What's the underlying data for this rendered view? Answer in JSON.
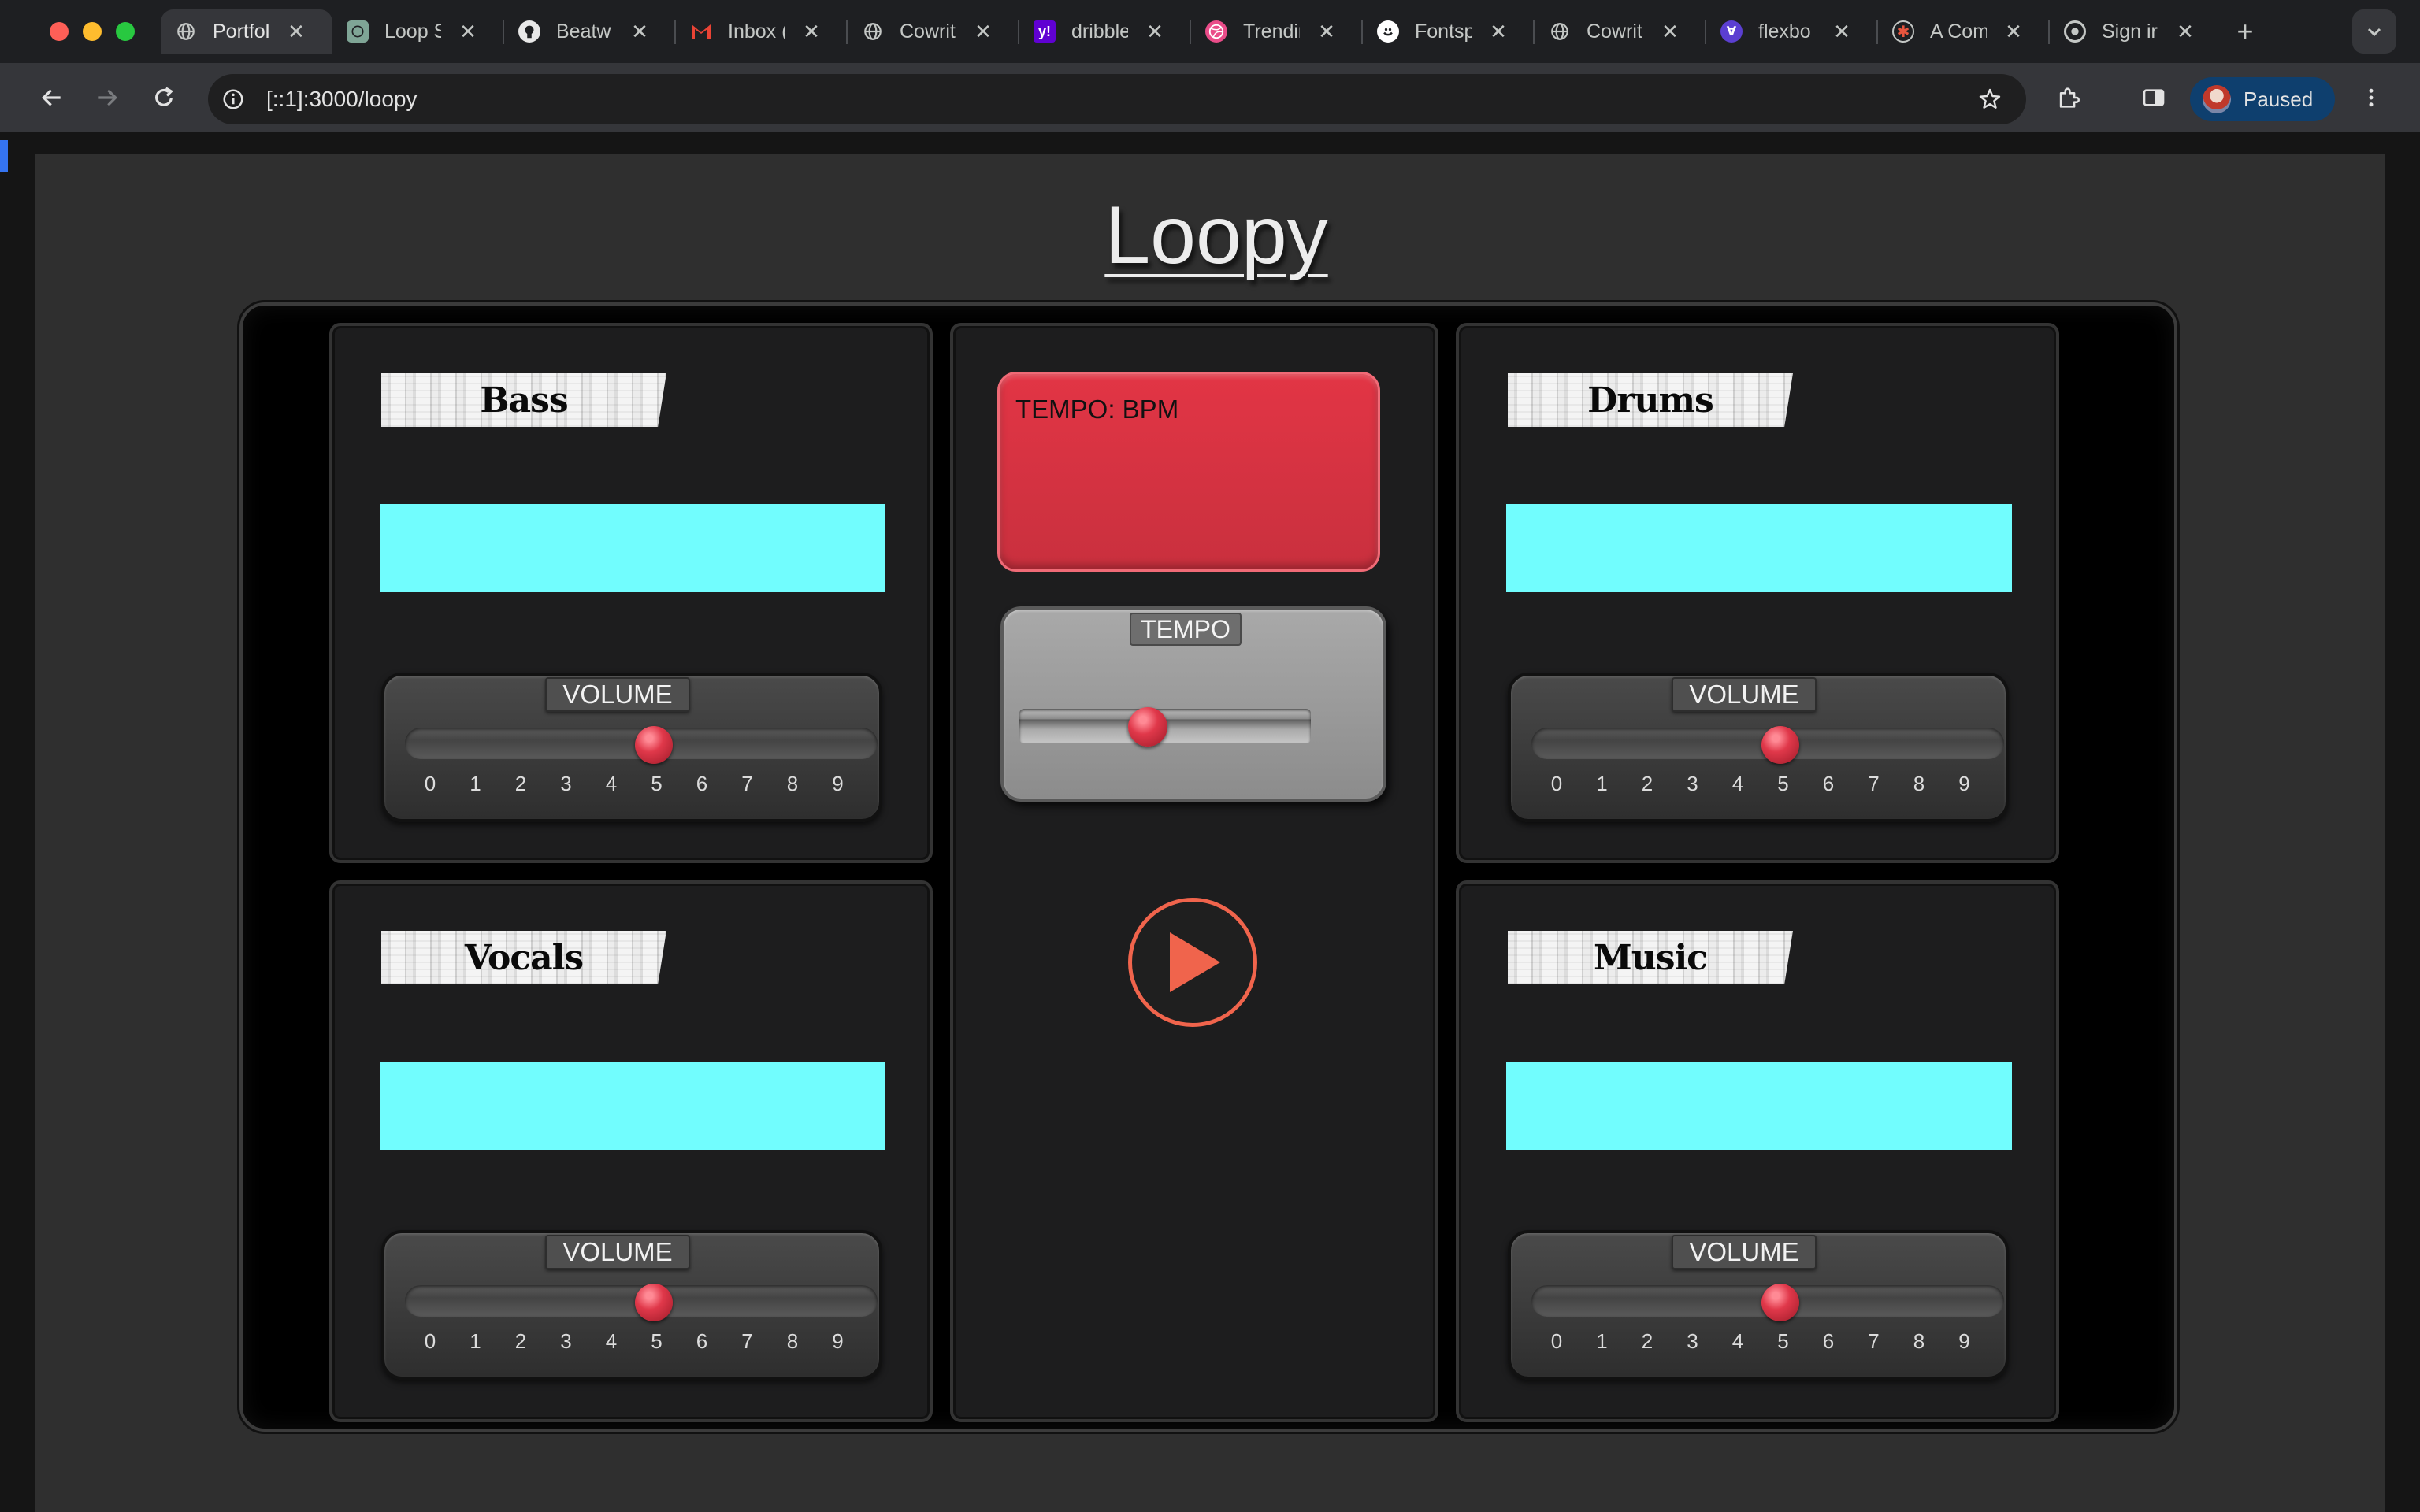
{
  "browser": {
    "tabs": [
      {
        "title": "Portfol",
        "favicon": "globe-icon",
        "active": true
      },
      {
        "title": "Loop S",
        "favicon": "globe-icon",
        "active": false
      },
      {
        "title": "Beatw",
        "favicon": "github-icon",
        "active": false
      },
      {
        "title": "Inbox (",
        "favicon": "gmail-icon",
        "active": false
      },
      {
        "title": "Cowrit",
        "favicon": "globe-icon",
        "active": false
      },
      {
        "title": "dribble",
        "favicon": "yahoo-icon",
        "active": false
      },
      {
        "title": "Trendir",
        "favicon": "dribbble-icon",
        "active": false
      },
      {
        "title": "Fontsp",
        "favicon": "fontspace-icon",
        "active": false
      },
      {
        "title": "Cowrit",
        "favicon": "globe-icon",
        "active": false
      },
      {
        "title": "flexbo",
        "favicon": "flexbox-icon",
        "active": false
      },
      {
        "title": "A Com",
        "favicon": "asterisk-icon",
        "active": false
      },
      {
        "title": "Sign ir",
        "favicon": "google-icon",
        "active": false
      }
    ],
    "new_tab_label": "+",
    "url": "[::1]:3000/loopy",
    "profile_label": "Paused"
  },
  "app": {
    "title": "Loopy",
    "tracks": {
      "bass": {
        "label": "Bass",
        "volume_label": "VOLUME",
        "volume": 5
      },
      "drums": {
        "label": "Drums",
        "volume_label": "VOLUME",
        "volume": 5
      },
      "vocals": {
        "label": "Vocals",
        "volume_label": "VOLUME",
        "volume": 5
      },
      "music": {
        "label": "Music",
        "volume_label": "VOLUME",
        "volume": 5
      }
    },
    "volume_scale": [
      "0",
      "1",
      "2",
      "3",
      "4",
      "5",
      "6",
      "7",
      "8",
      "9"
    ],
    "tempo": {
      "readout": "TEMPO: BPM",
      "slider_label": "TEMPO",
      "level": 0.44
    },
    "play": {
      "icon": "play-icon"
    }
  },
  "colors": {
    "display_cyan": "#71fdfe",
    "tempo_red": "#dc3545",
    "play_accent": "#f0644c",
    "knob_red": "#e0384a"
  }
}
